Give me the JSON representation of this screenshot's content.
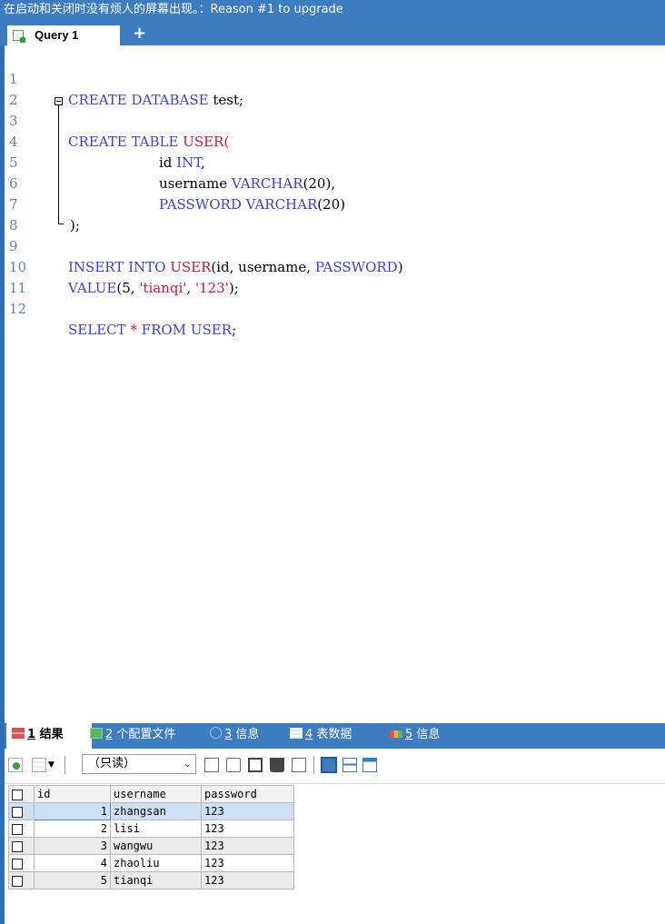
{
  "banner": {
    "text": "在启动和关闭时没有烦人的屏幕出现。：Reason #1 to upgrade"
  },
  "query_tab": {
    "label": "Query 1",
    "add_label": "+"
  },
  "editor": {
    "lines": [
      {
        "n": "1"
      },
      {
        "n": "2"
      },
      {
        "n": "3"
      },
      {
        "n": "4"
      },
      {
        "n": "5"
      },
      {
        "n": "6"
      },
      {
        "n": "7"
      },
      {
        "n": "8"
      },
      {
        "n": "9"
      },
      {
        "n": "10"
      },
      {
        "n": "11"
      },
      {
        "n": "12"
      }
    ],
    "code": {
      "l1_kw": "CREATE DATABASE",
      "l1_rest": " test;",
      "l3_kw": "CREATE TABLE",
      "l3_fn": " USER(",
      "l4_a": "id",
      "l4_kw": " INT",
      "l4_p": ",",
      "l5_a": "username",
      "l5_kw": " VARCHAR",
      "l5_p": "(20),",
      "l6_kw1": "PASSWORD",
      "l6_kw2": " VARCHAR",
      "l6_p": "(20)",
      "l7": ");",
      "l9_kw": "INSERT INTO",
      "l9_fn": " USER",
      "l9_p1": "(id, username, ",
      "l9_kw2": "PASSWORD",
      "l9_p2": ")",
      "l10_kw": "VALUE",
      "l10_p1": "(5, ",
      "l10_s1": "'tianqi'",
      "l10_p2": ", ",
      "l10_s2": "'123'",
      "l10_p3": ");",
      "l12_kw": "SELECT",
      "l12_op": " * ",
      "l12_kw2": "FROM USER",
      "l12_p": ";"
    }
  },
  "result_tabs": [
    {
      "num": "1",
      "label": "结果"
    },
    {
      "num": "2",
      "label": "个配置文件"
    },
    {
      "num": "3",
      "label": "信息"
    },
    {
      "num": "4",
      "label": "表数据"
    },
    {
      "num": "5",
      "label": "信息"
    }
  ],
  "result_toolbar": {
    "mode_select": "（只读）"
  },
  "grid": {
    "columns": [
      "id",
      "username",
      "password"
    ],
    "rows": [
      {
        "id": "1",
        "username": "zhangsan",
        "password": "123"
      },
      {
        "id": "2",
        "username": "lisi",
        "password": "123"
      },
      {
        "id": "3",
        "username": "wangwu",
        "password": "123"
      },
      {
        "id": "4",
        "username": "zhaoliu",
        "password": "123"
      },
      {
        "id": "5",
        "username": "tianqi",
        "password": "123"
      }
    ]
  },
  "colors": {
    "accent": "#3d7cbf",
    "keyword": "#3e3ee0",
    "string": "#c81a3a",
    "selected_row": "#cde0f4"
  }
}
